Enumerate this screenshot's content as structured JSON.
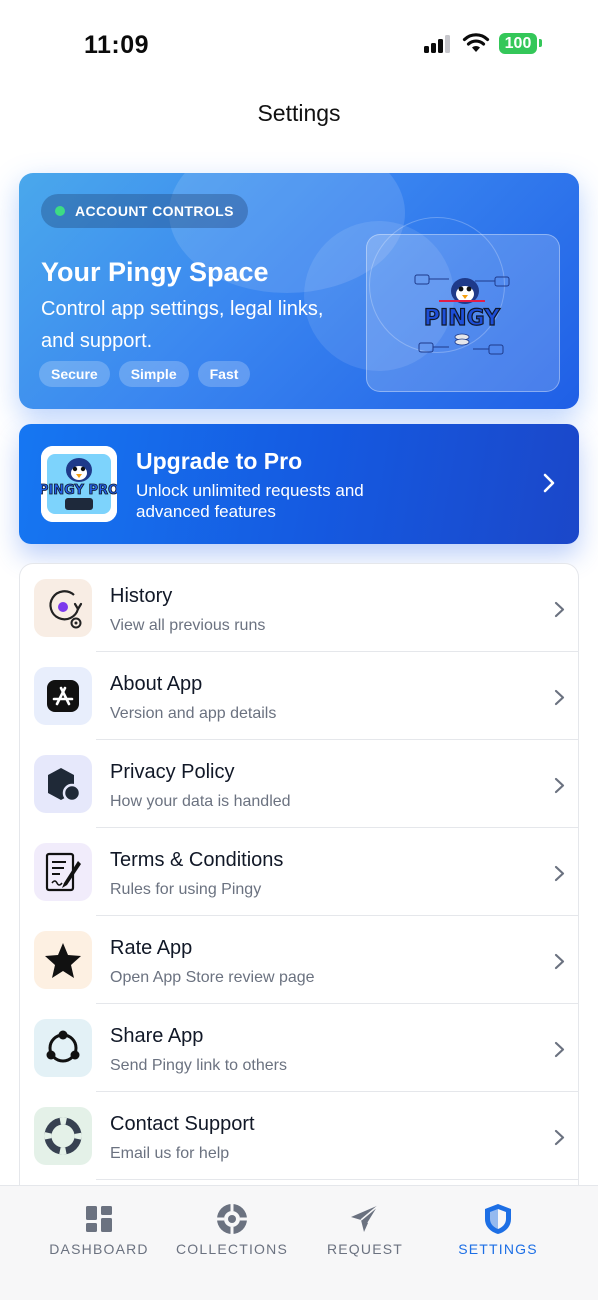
{
  "status_bar": {
    "time": "11:09",
    "battery": "100"
  },
  "page_title": "Settings",
  "hero": {
    "badge": "ACCOUNT CONTROLS",
    "title": "Your Pingy Space",
    "subtitle": "Control app settings, legal links, and support.",
    "tags": [
      "Secure",
      "Simple",
      "Fast"
    ],
    "logo_text": "PINGY"
  },
  "pro_banner": {
    "title": "Upgrade to Pro",
    "subtitle": "Unlock unlimited requests and advanced features",
    "icon_text": "PINGY PRO"
  },
  "settings_list": [
    {
      "title": "History",
      "subtitle": "View all previous runs",
      "icon": "history-icon"
    },
    {
      "title": "About App",
      "subtitle": "Version and app details",
      "icon": "app-store-icon"
    },
    {
      "title": "Privacy Policy",
      "subtitle": "How your data is handled",
      "icon": "privacy-shield-icon"
    },
    {
      "title": "Terms & Conditions",
      "subtitle": "Rules for using Pingy",
      "icon": "document-sign-icon"
    },
    {
      "title": "Rate App",
      "subtitle": "Open App Store review page",
      "icon": "star-icon"
    },
    {
      "title": "Share App",
      "subtitle": "Send Pingy link to others",
      "icon": "share-icon"
    },
    {
      "title": "Contact Support",
      "subtitle": "Email us for help",
      "icon": "lifebuoy-icon"
    }
  ],
  "tab_bar": {
    "tabs": [
      {
        "label": "DASHBOARD",
        "icon": "dashboard-icon"
      },
      {
        "label": "COLLECTIONS",
        "icon": "collections-icon"
      },
      {
        "label": "REQUEST",
        "icon": "paper-plane-icon"
      },
      {
        "label": "SETTINGS",
        "icon": "shield-icon"
      }
    ],
    "active": "SETTINGS"
  },
  "colors": {
    "accent": "#1d6fe5",
    "hero_start": "#4aa8ec",
    "hero_end": "#1f5fe6",
    "status_green": "#34c759"
  }
}
